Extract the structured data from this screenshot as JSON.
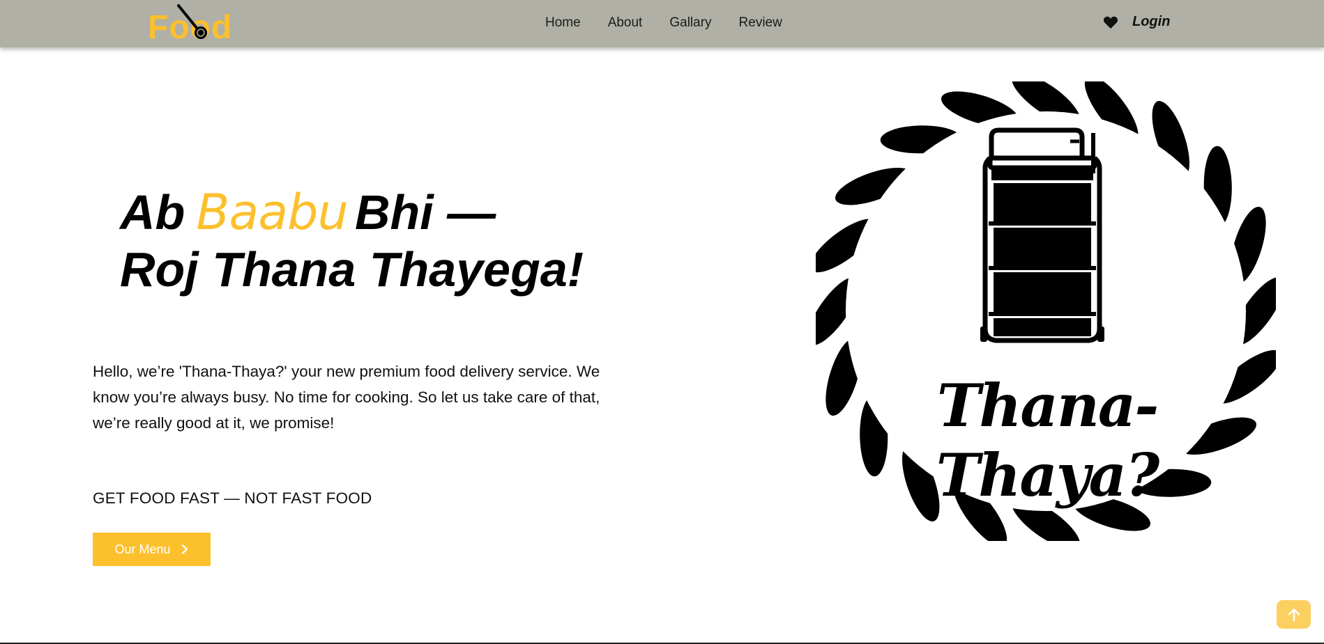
{
  "brand": {
    "name": "Food",
    "color": "#fcc02d"
  },
  "nav": {
    "links": [
      "Home",
      "About",
      "Gallary",
      "Review"
    ],
    "login_label": "Login",
    "background": "#b0b0a6"
  },
  "hero": {
    "headline_part1": "Ab",
    "headline_accent": "Baabu",
    "headline_part2": "Bhi —",
    "headline_line2": "Roj Thana Thayega!",
    "intro": "Hello, we’re 'Thana-Thaya?' your new premium food delivery service. We know you’re always busy. No time for cooking. So let us take care of that, we’re really good at it, we promise!",
    "tagline": "GET FOOD FAST — NOT FAST FOOD",
    "menu_button": "Our Menu"
  },
  "emblem": {
    "title": "Thana-Thaya?"
  },
  "icons": [
    "whisk-spoon-icon",
    "heart-icon",
    "chevron-right-icon",
    "arrow-up-icon",
    "tiffin-icon"
  ],
  "colors": {
    "accent": "#fcc02d",
    "text": "#000000"
  }
}
